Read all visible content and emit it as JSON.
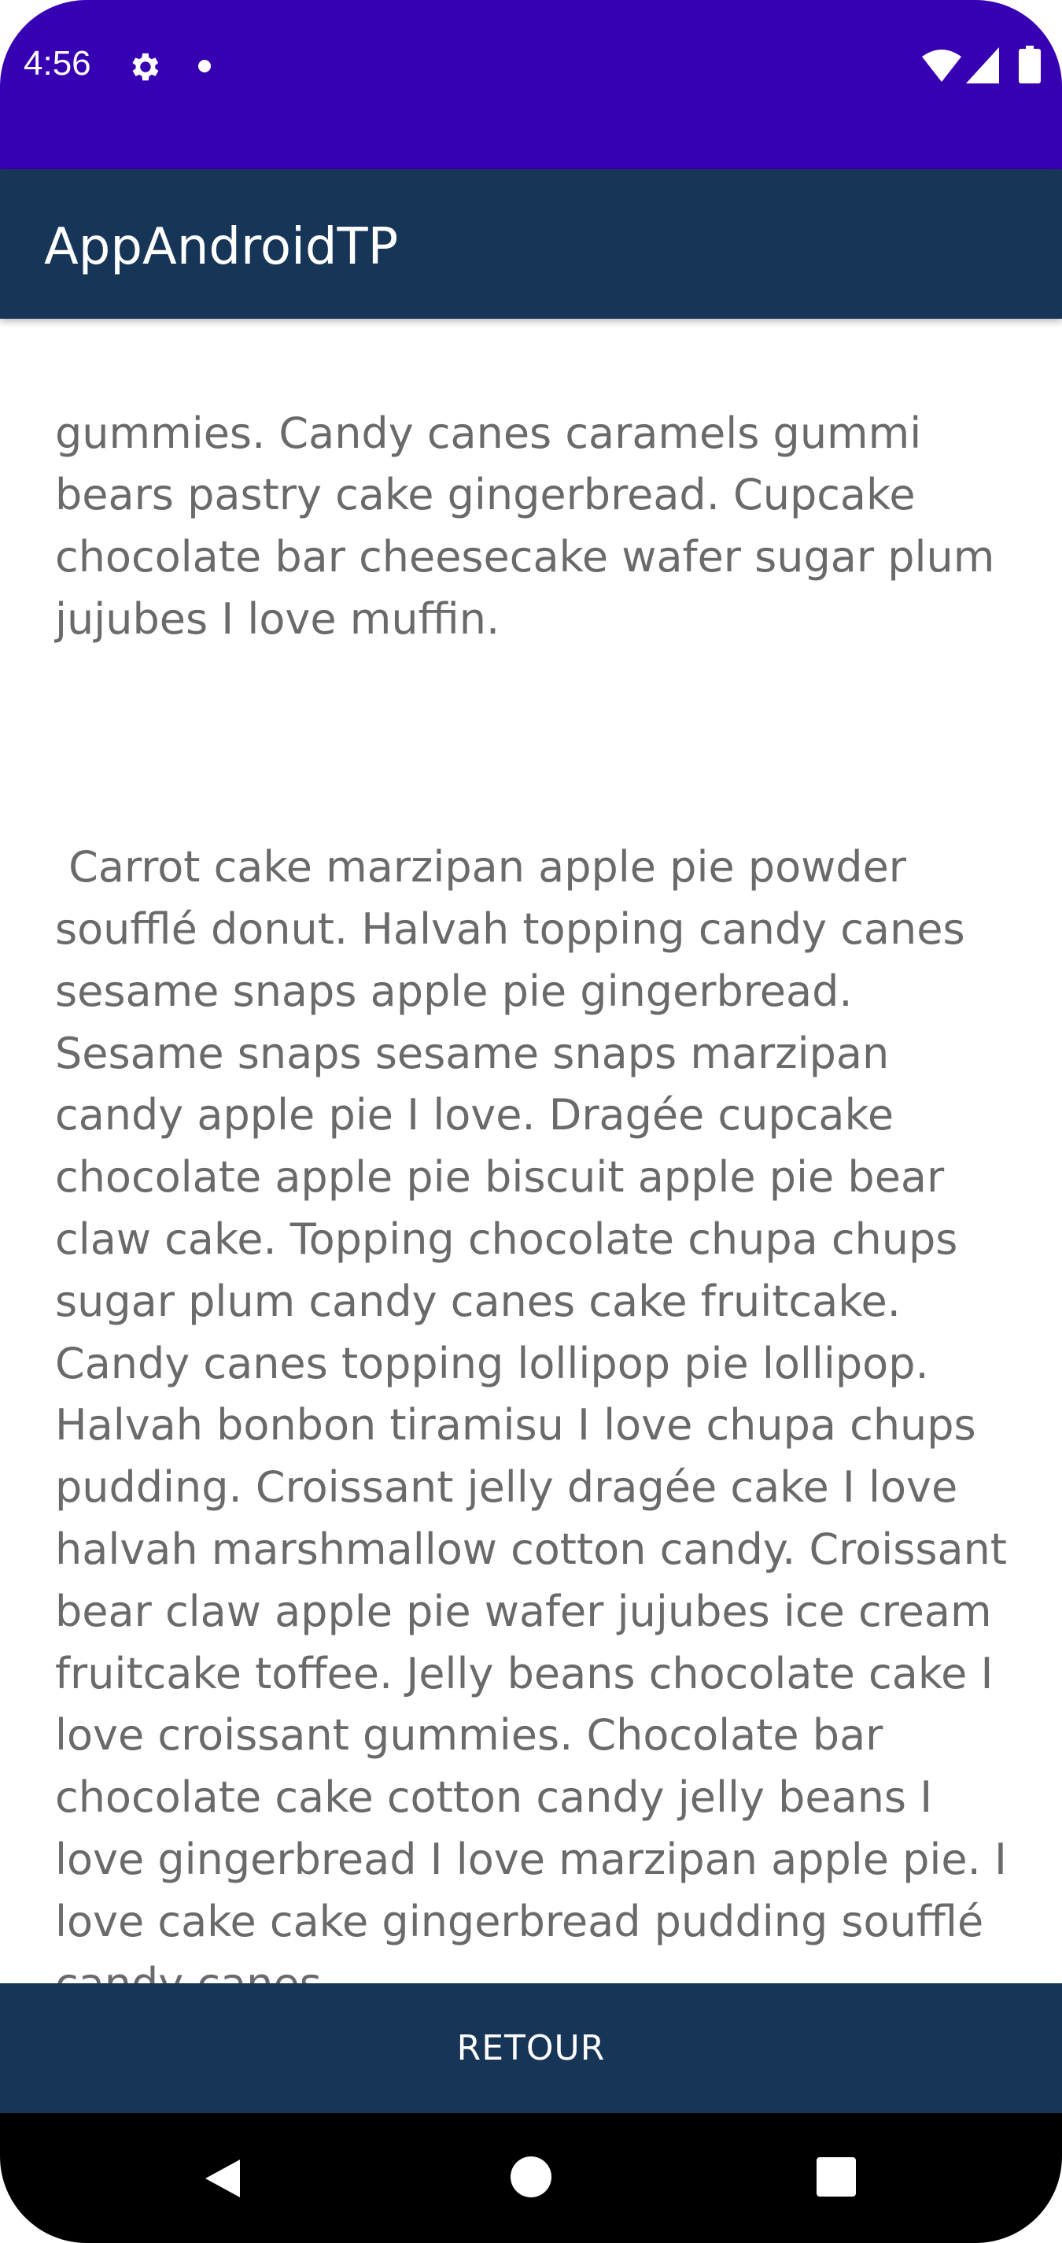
{
  "status_bar": {
    "time": "4:56",
    "background": "#3700b3"
  },
  "app_bar": {
    "title": "AppAndroidTP",
    "background": "#163557"
  },
  "content": {
    "paragraphs": [
      "gummies. Candy canes caramels gummi bears pastry cake gingerbread. Cupcake chocolate bar cheesecake wafer sugar plum jujubes I love muffin.",
      " Carrot cake marzipan apple pie powder soufflé donut. Halvah topping candy canes sesame snaps apple pie gingerbread. Sesame snaps sesame snaps marzipan candy apple pie I love. Dragée cupcake chocolate apple pie biscuit apple pie bear claw cake. Topping chocolate chupa chups sugar plum candy canes cake fruitcake. Candy canes topping lollipop pie lollipop. Halvah bonbon tiramisu I love chupa chups pudding. Croissant jelly dragée cake I love halvah marshmallow cotton candy. Croissant bear claw apple pie wafer jujubes ice cream fruitcake toffee. Jelly beans chocolate cake I love croissant gummies. Chocolate bar chocolate cake cotton candy jelly beans I love gingerbread I love marzipan apple pie. I love cake cake gingerbread pudding soufflé candy canes."
    ],
    "text_color": "#6a6a6a"
  },
  "footer": {
    "retour_label": "RETOUR",
    "background": "#163557"
  },
  "icons": {
    "status": [
      "gear-icon",
      "notification-dot-icon",
      "wifi-icon",
      "signal-icon",
      "battery-icon"
    ],
    "nav": [
      "back-icon",
      "home-icon",
      "recents-icon"
    ]
  }
}
